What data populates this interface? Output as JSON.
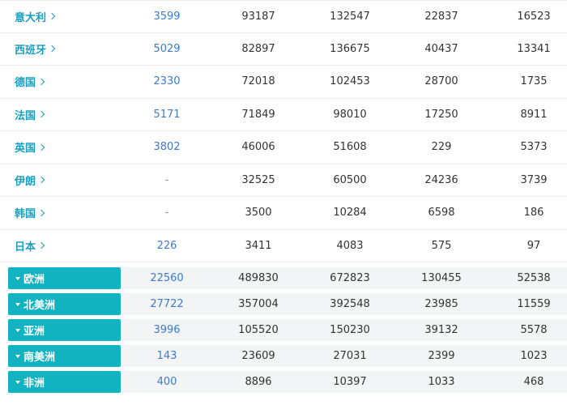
{
  "countries": [
    {
      "name": "意大利",
      "v": [
        "3599",
        "93187",
        "132547",
        "22837",
        "16523"
      ]
    },
    {
      "name": "西班牙",
      "v": [
        "5029",
        "82897",
        "136675",
        "40437",
        "13341"
      ]
    },
    {
      "name": "德国",
      "v": [
        "2330",
        "72018",
        "102453",
        "28700",
        "1735"
      ]
    },
    {
      "name": "法国",
      "v": [
        "5171",
        "71849",
        "98010",
        "17250",
        "8911"
      ]
    },
    {
      "name": "英国",
      "v": [
        "3802",
        "46006",
        "51608",
        "229",
        "5373"
      ]
    },
    {
      "name": "伊朗",
      "v": [
        "-",
        "32525",
        "60500",
        "24236",
        "3739"
      ]
    },
    {
      "name": "韩国",
      "v": [
        "-",
        "3500",
        "10284",
        "6598",
        "186"
      ]
    },
    {
      "name": "日本",
      "v": [
        "226",
        "3411",
        "4083",
        "575",
        "97"
      ]
    }
  ],
  "continents": [
    {
      "name": "欧洲",
      "v": [
        "22560",
        "489830",
        "672823",
        "130455",
        "52538"
      ]
    },
    {
      "name": "北美洲",
      "v": [
        "27722",
        "357004",
        "392548",
        "23985",
        "11559"
      ]
    },
    {
      "name": "亚洲",
      "v": [
        "3996",
        "105520",
        "150230",
        "39132",
        "5578"
      ]
    },
    {
      "name": "南美洲",
      "v": [
        "143",
        "23609",
        "27031",
        "2399",
        "1023"
      ]
    },
    {
      "name": "非洲",
      "v": [
        "400",
        "8896",
        "10397",
        "1033",
        "468"
      ]
    }
  ],
  "colors": {
    "accent": "#12b3c0",
    "link": "#1b9fc0",
    "number_link": "#3a7bd5",
    "stripe": "#f3f4f6"
  }
}
